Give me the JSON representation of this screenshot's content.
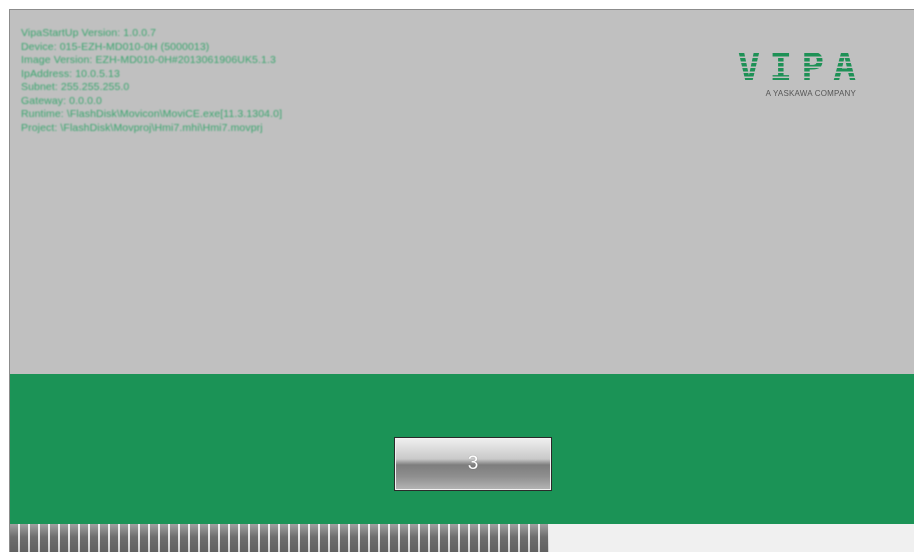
{
  "info_lines": [
    "VipaStartUp Version: 1.0.0.7",
    "Device: 015-EZH-MD010-0H (5000013)",
    "Image Version: EZH-MD010-0H#2013061906UK5.1.3",
    "IpAddress: 10.0.5.13",
    "Subnet: 255.255.255.0",
    "Gateway: 0.0.0.0",
    "Runtime: \\FlashDisk\\Movicon\\MoviCE.exe[11.3.1304.0]",
    "Project: \\FlashDisk\\Movproj\\Hmi7.mhi\\Hmi7.movprj"
  ],
  "logo": {
    "text": "VIPA",
    "tagline": "A YASKAWA COMPANY"
  },
  "countdown_button": {
    "label": "3"
  },
  "progress": {
    "fraction": 0.596
  },
  "colors": {
    "screen_background": "#c0c0c0",
    "green_band": "#1b9356",
    "info_text": "#21a05f",
    "logo_green": "#1e9156"
  }
}
